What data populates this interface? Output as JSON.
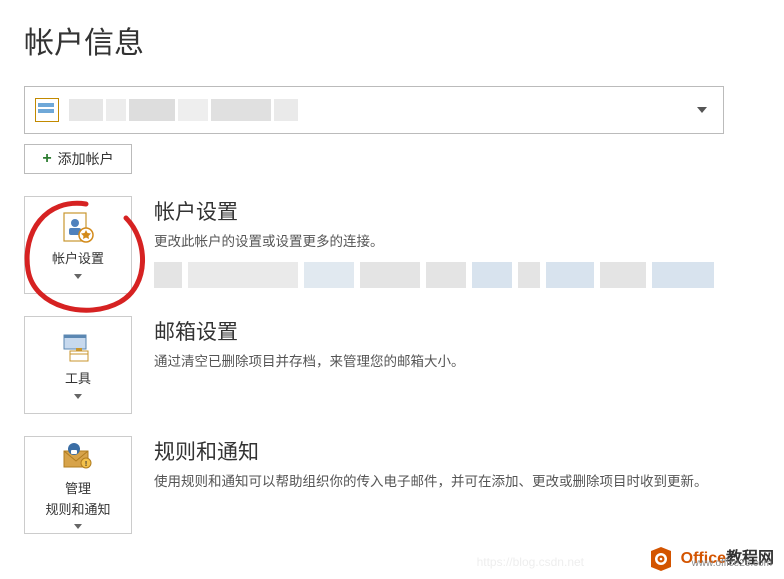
{
  "page_title": "帐户信息",
  "account_select": {
    "caret": "▼"
  },
  "add_account": {
    "label": "添加帐户",
    "plus": "+"
  },
  "sections": {
    "account": {
      "tile_label": "帐户设置",
      "title": "帐户设置",
      "desc": "更改此帐户的设置或设置更多的连接。"
    },
    "mailbox": {
      "tile_label": "工具",
      "title": "邮箱设置",
      "desc": "通过清空已删除项目并存档，来管理您的邮箱大小。"
    },
    "rules": {
      "tile_label1": "管理",
      "tile_label2": "规则和通知",
      "title": "规则和通知",
      "desc": "使用规则和通知可以帮助组织你的传入电子邮件，并可在添加、更改或删除项目时收到更新。"
    }
  },
  "watermark": {
    "text1": "Office",
    "text2": "教程网",
    "url": "www.office26.com"
  },
  "faint_url": "https://blog.csdn.net"
}
